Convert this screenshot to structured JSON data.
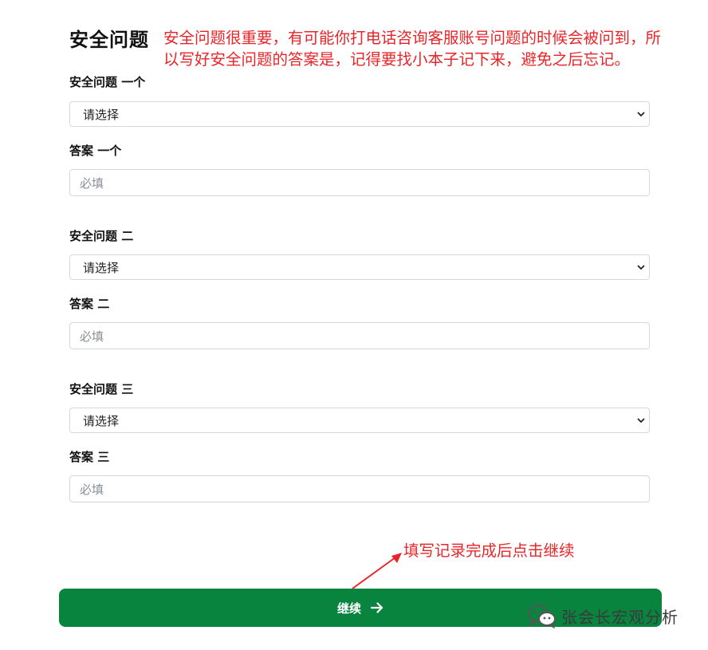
{
  "page": {
    "title": "安全问题",
    "note": "安全问题很重要，有可能你打电话咨询客服账号问题的时候会被问到，所以写好安全问题的答案是，记得要找小本子记下来，避免之后忘记。"
  },
  "questions": [
    {
      "question_label": "安全问题 一个",
      "select_value": "请选择",
      "answer_label": "答案 一个",
      "answer_placeholder": "必填"
    },
    {
      "question_label": "安全问题 二",
      "select_value": "请选择",
      "answer_label": "答案 二",
      "answer_placeholder": "必填"
    },
    {
      "question_label": "安全问题 三",
      "select_value": "请选择",
      "answer_label": "答案 三",
      "answer_placeholder": "必填"
    }
  ],
  "annotation": {
    "text": "填写记录完成后点击继续",
    "color": "#e8262a"
  },
  "continue_button": {
    "label": "继续",
    "icon": "arrow-right-icon",
    "color": "#08843e"
  },
  "watermark": {
    "text": "张会长宏观分析",
    "icon": "wechat-icon"
  }
}
